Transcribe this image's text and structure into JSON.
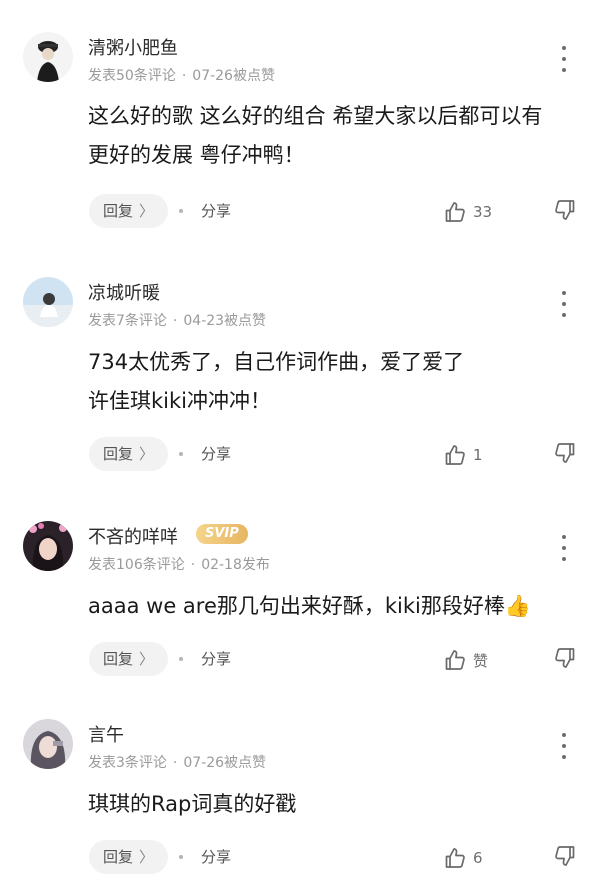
{
  "comments": [
    {
      "username": "清粥小肥鱼",
      "stats": "发表50条评论",
      "dot": "·",
      "time": "07-26被点赞",
      "lines": [
        "这么好的歌 这么好的组合 希望大家以后都可以有",
        "更好的发展 粤仔冲鸭！"
      ],
      "reply_label": "回复",
      "reply_chevron": "〉",
      "share_label": "分享",
      "like_count": "33"
    },
    {
      "username": "凉城听暖",
      "stats": "发表7条评论",
      "dot": "·",
      "time": "04-23被点赞",
      "lines": [
        "734太优秀了，自己作词作曲，爱了爱了",
        "许佳琪kiki冲冲冲！"
      ],
      "reply_label": "回复",
      "reply_chevron": "〉",
      "share_label": "分享",
      "like_count": "1"
    },
    {
      "username": "不吝的咩咩",
      "badge": "SVIP",
      "stats": "发表106条评论",
      "dot": "·",
      "time": "02-18发布",
      "lines": [
        "aaaa we are那几句出来好酥，kiki那段好棒👍"
      ],
      "reply_label": "回复",
      "reply_chevron": "〉",
      "share_label": "分享",
      "like_count": "赞"
    },
    {
      "username": "言午",
      "stats": "发表3条评论",
      "dot": "·",
      "time": "07-26被点赞",
      "lines": [
        "琪琪的Rap词真的好戳"
      ],
      "reply_label": "回复",
      "reply_chevron": "〉",
      "share_label": "分享",
      "like_count": "6"
    }
  ],
  "colors": {
    "text": "#1a1a1a",
    "meta": "#9a9a9a",
    "pill": "#f2f2f2",
    "svip": "#e6b561"
  }
}
